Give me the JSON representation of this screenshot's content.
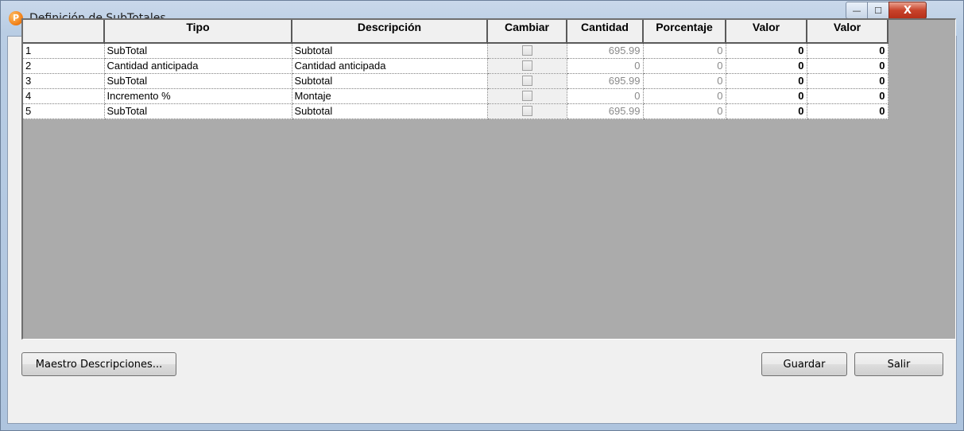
{
  "window": {
    "title": "Definición de SubTotales",
    "app_icon_letter": "P",
    "controls": {
      "minimize": "—",
      "maximize": "☐",
      "close": "X"
    }
  },
  "grid": {
    "columns": [
      "",
      "Tipo",
      "Descripción",
      "Cambiar",
      "Cantidad",
      "Porcentaje",
      "Valor",
      "Valor"
    ],
    "rows": [
      {
        "num": "1",
        "tipo": "SubTotal",
        "descripcion": "Subtotal",
        "cantidad": "695.99",
        "porcentaje": "0",
        "valor_min": "0",
        "valor_max": "0"
      },
      {
        "num": "2",
        "tipo": "Cantidad anticipada",
        "descripcion": "Cantidad anticipada",
        "cantidad": "0",
        "porcentaje": "0",
        "valor_min": "0",
        "valor_max": "0"
      },
      {
        "num": "3",
        "tipo": "SubTotal",
        "descripcion": "Subtotal",
        "cantidad": "695.99",
        "porcentaje": "0",
        "valor_min": "0",
        "valor_max": "0"
      },
      {
        "num": "4",
        "tipo": "Incremento %",
        "descripcion": "Montaje",
        "cantidad": "0",
        "porcentaje": "0",
        "valor_min": "0",
        "valor_max": "0"
      },
      {
        "num": "5",
        "tipo": "SubTotal",
        "descripcion": "Subtotal",
        "cantidad": "695.99",
        "porcentaje": "0",
        "valor_min": "0",
        "valor_max": "0"
      }
    ]
  },
  "buttons": {
    "maestro": "Maestro Descripciones...",
    "guardar": "Guardar",
    "salir": "Salir"
  }
}
